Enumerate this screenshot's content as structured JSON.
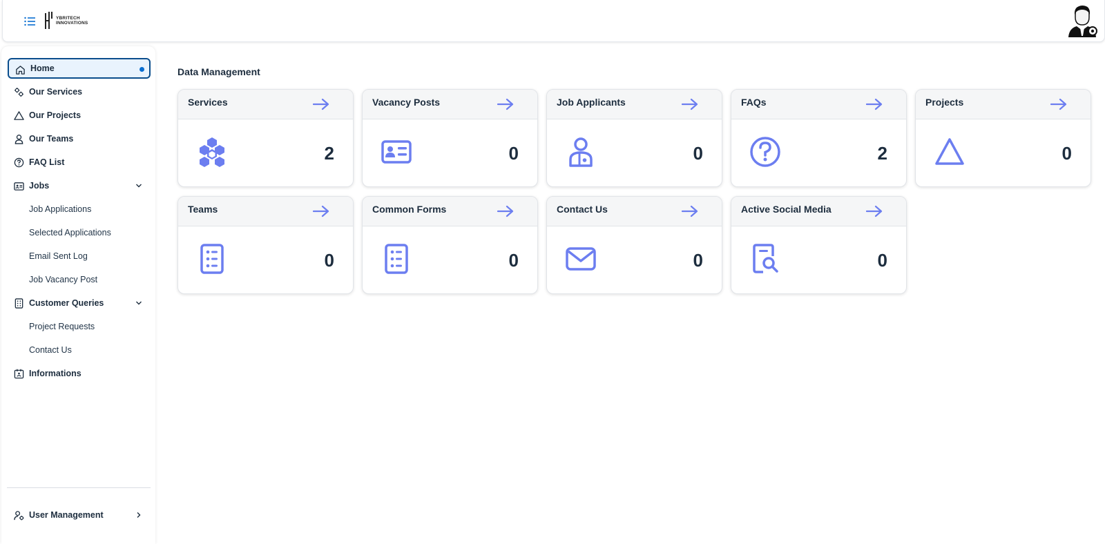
{
  "header": {
    "menu_icon": "list-icon",
    "logo_text_line1": "YBRITECH",
    "logo_text_line2": "INNOVATIONS",
    "avatar_icon": "user-avatar-icon"
  },
  "sidebar": {
    "items": [
      {
        "label": "Home",
        "icon": "home-icon",
        "active": true
      },
      {
        "label": "Our Services",
        "icon": "gears-icon"
      },
      {
        "label": "Our Projects",
        "icon": "triangle-icon"
      },
      {
        "label": "Our Teams",
        "icon": "person-icon"
      },
      {
        "label": "FAQ List",
        "icon": "question-circle-icon"
      },
      {
        "label": "Jobs",
        "icon": "id-card-icon",
        "expanded": true
      },
      {
        "label": "Job Applications"
      },
      {
        "label": "Selected Applications"
      },
      {
        "label": "Email Sent Log"
      },
      {
        "label": "Job Vacancy Post"
      },
      {
        "label": "Customer Queries",
        "icon": "form-icon",
        "expanded": true
      },
      {
        "label": "Project Requests"
      },
      {
        "label": "Contact Us"
      },
      {
        "label": "Informations",
        "icon": "calendar-badge-icon"
      }
    ],
    "footer": {
      "label": "User Management",
      "icon": "user-settings-icon"
    }
  },
  "main": {
    "section_title": "Data Management",
    "cards": [
      {
        "title": "Services",
        "count": "2",
        "icon": "cube-cluster-icon"
      },
      {
        "title": "Vacancy Posts",
        "count": "0",
        "icon": "id-card-icon"
      },
      {
        "title": "Job Applicants",
        "count": "0",
        "icon": "person-badge-icon"
      },
      {
        "title": "FAQs",
        "count": "2",
        "icon": "question-circle-icon"
      },
      {
        "title": "Projects",
        "count": "0",
        "icon": "triangle-icon"
      },
      {
        "title": "Teams",
        "count": "0",
        "icon": "form-icon"
      },
      {
        "title": "Common Forms",
        "count": "0",
        "icon": "form-icon"
      },
      {
        "title": "Contact Us",
        "count": "0",
        "icon": "envelope-icon"
      },
      {
        "title": "Active Social Media",
        "count": "0",
        "icon": "document-search-icon"
      }
    ]
  },
  "colors": {
    "accent": "#6c7ef0",
    "active_border": "#0a4d8c",
    "active_bg": "#e9f3fd",
    "text": "#1d2d3e"
  }
}
